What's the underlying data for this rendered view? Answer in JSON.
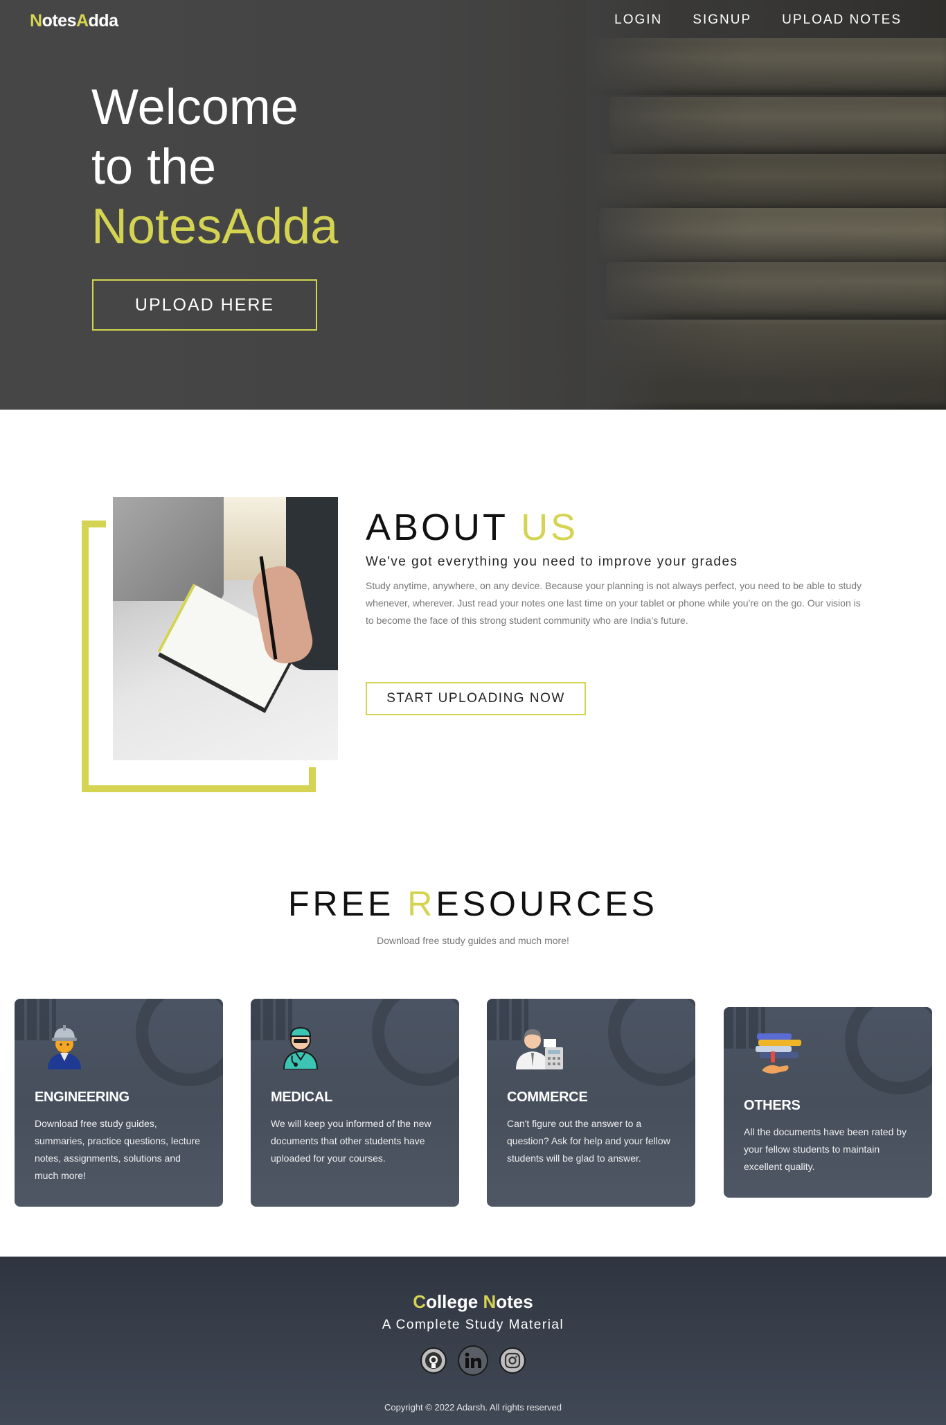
{
  "navbar": {
    "logo_first": "N",
    "logo_mid": "otes",
    "logo_accent": "A",
    "logo_rest": "dda",
    "links": [
      "LOGIN",
      "SIGNUP",
      "UPLOAD NOTES"
    ]
  },
  "hero": {
    "line1": "Welcome",
    "line2": "to the",
    "line3": "NotesAdda",
    "button_label": "UPLOAD HERE"
  },
  "about": {
    "heading_main": "ABOUT ",
    "heading_accent": "US",
    "subtitle": "We've got everything you need to improve your grades",
    "text": "Study anytime, anywhere, on any device. Because your planning is not always perfect, you need to be able to study whenever, wherever. Just read your notes one last time on your tablet or phone while you're on the go. Our vision is to become the face of this strong student community who are India's future.",
    "button_label": "START UPLOADING NOW"
  },
  "resources": {
    "heading_first": "FREE ",
    "heading_accent": "R",
    "heading_rest": "ESOURCES",
    "subtitle": "Download free study guides and much more!",
    "cards": [
      {
        "icon": "engineer-icon",
        "title": "ENGINEERING",
        "text": "Download free study guides, summaries, practice questions, lecture notes, assignments, solutions and much more!"
      },
      {
        "icon": "doctor-icon",
        "title": "MEDICAL",
        "text": "We will keep you informed of the new documents that other students have uploaded for your courses."
      },
      {
        "icon": "accountant-icon",
        "title": "COMMERCE",
        "text": "Can't figure out the answer to a question? Ask for help and your fellow students will be glad to answer."
      },
      {
        "icon": "books-icon",
        "title": "OTHERS",
        "text": "All the documents have been rated by your fellow students to maintain excellent quality."
      }
    ]
  },
  "footer": {
    "brand_c": "C",
    "brand_ollege": "ollege ",
    "brand_n": "N",
    "brand_otes": "otes",
    "tagline": "A Complete Study Material",
    "social": [
      "github-icon",
      "linkedin-icon",
      "instagram-icon"
    ],
    "copyright": "Copyright © 2022 Adarsh. All rights reserved"
  },
  "colors": {
    "accent": "#d4d452",
    "hero_bg": "#444444",
    "card_bg": "#4b5463",
    "footer_bg": "#353b46"
  }
}
